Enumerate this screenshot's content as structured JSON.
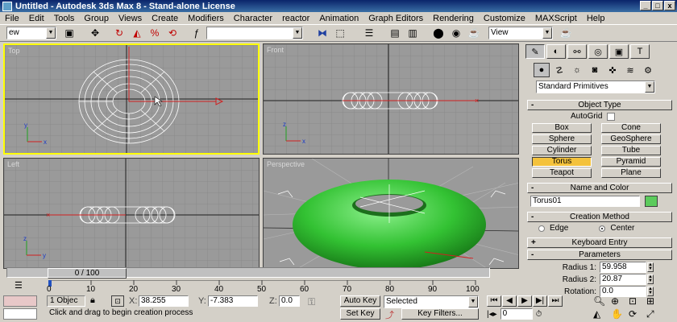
{
  "window": {
    "title": "Untitled - Autodesk 3ds Max 8 - Stand-alone License",
    "min": "_",
    "max": "□",
    "close": "x"
  },
  "menu": [
    "File",
    "Edit",
    "Tools",
    "Group",
    "Views",
    "Create",
    "Modifiers",
    "Character",
    "reactor",
    "Animation",
    "Graph Editors",
    "Rendering",
    "Customize",
    "MAXScript",
    "Help"
  ],
  "toolbar": {
    "selection_filter": "ew",
    "named_selection": "",
    "view_combo": "View"
  },
  "viewports": {
    "top": "Top",
    "front": "Front",
    "left": "Left",
    "perspective": "Perspective"
  },
  "command_panel": {
    "category": "Standard Primitives",
    "object_type": {
      "title": "Object Type",
      "autogrid": "AutoGrid",
      "buttons": [
        "Box",
        "Cone",
        "Sphere",
        "GeoSphere",
        "Cylinder",
        "Tube",
        "Torus",
        "Pyramid",
        "Teapot",
        "Plane"
      ],
      "selected": "Torus"
    },
    "name_color": {
      "title": "Name and Color",
      "name": "Torus01",
      "color": "#5ccb5c"
    },
    "creation_method": {
      "title": "Creation Method",
      "edge": "Edge",
      "center": "Center",
      "selected": "Center"
    },
    "keyboard_entry": {
      "title": "Keyboard Entry"
    },
    "parameters": {
      "title": "Parameters",
      "radius1_label": "Radius 1:",
      "radius1": "59.958",
      "radius2_label": "Radius 2:",
      "radius2": "20.87",
      "rotation_label": "Rotation:",
      "rotation": "0.0"
    }
  },
  "timeline": {
    "slider": "0 / 100",
    "ticks": [
      "0",
      "10",
      "20",
      "30",
      "40",
      "50",
      "60",
      "70",
      "80",
      "90",
      "100"
    ]
  },
  "status": {
    "objects": "1 Objec",
    "x_label": "X:",
    "x": "38.255",
    "y_label": "Y:",
    "y": "-7.383",
    "z_label": "Z:",
    "z": "0.0",
    "prompt": "Click and drag to begin creation process",
    "auto_key": "Auto Key",
    "set_key": "Set Key",
    "key_mode": "Selected",
    "key_filters": "Key Filters...",
    "frame": "0"
  },
  "colors": {
    "torus": "#33c233",
    "active_border": "#ffff00",
    "viewport_bg": "#9a9a9a"
  }
}
